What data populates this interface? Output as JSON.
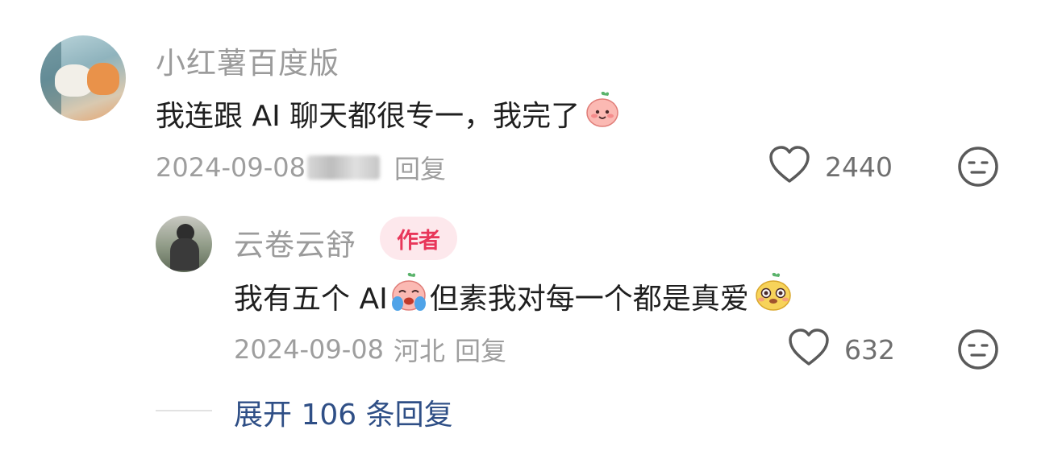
{
  "comment": {
    "username": "小红薯百度版",
    "content_text": "我连跟 AI 聊天都很专一，我完了",
    "date": "2024-09-08",
    "location": "日本",
    "reply_label": "回复",
    "like_count": "2440",
    "emoji_1": "pink-blob-smile-emoji"
  },
  "reply": {
    "username": "云卷云舒",
    "author_badge": "作者",
    "content_part1": "我有五个 AI",
    "content_part2": "但素我对每一个都是真爱",
    "date": "2024-09-08",
    "location": "河北",
    "reply_label": "回复",
    "like_count": "632",
    "emoji_1": "crying-blob-emoji",
    "emoji_2": "yellow-blob-grin-emoji"
  },
  "expand": {
    "label": "展开 106 条回复"
  },
  "icons": {
    "like": "heart-outline-icon",
    "dislike": "neutral-face-icon"
  },
  "colors": {
    "username": "#9b9b9b",
    "content": "#1f1f1f",
    "meta": "#9e9e9e",
    "badge_bg": "#fde8ec",
    "badge_text": "#e8375a",
    "expand_link": "#2f4f86"
  }
}
